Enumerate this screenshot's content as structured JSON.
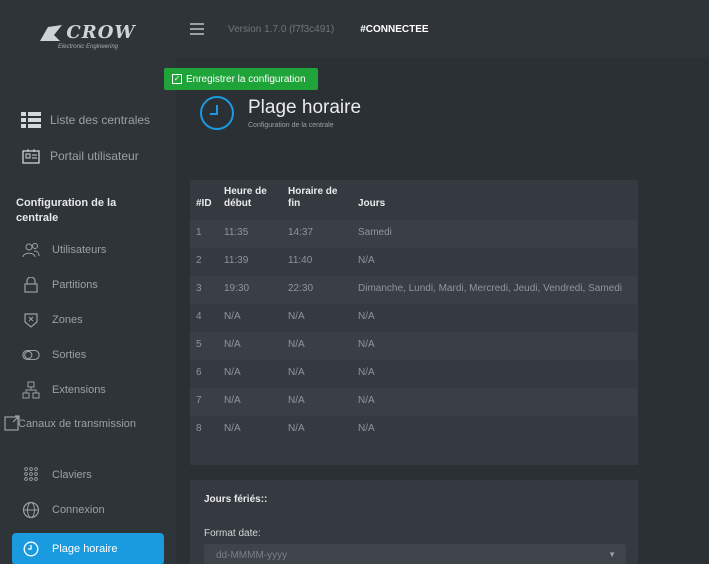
{
  "brand": {
    "name": "CROW",
    "tagline": "Electronic Engineering"
  },
  "topbar": {
    "version": "Version 1.7.0 (f7f3c491)",
    "status": "#CONNECTEE"
  },
  "toolbar": {
    "save_label": "Enregistrer la configuration"
  },
  "nav": {
    "links": [
      {
        "label": "Liste des centrales",
        "icon": "list-icon"
      },
      {
        "label": "Portail utilisateur",
        "icon": "portal-icon"
      }
    ],
    "section_title": "Configuration de la centrale",
    "items": [
      {
        "label": "Utilisateurs",
        "icon": "users-icon"
      },
      {
        "label": "Partitions",
        "icon": "partitions-icon"
      },
      {
        "label": "Zones",
        "icon": "zones-icon"
      },
      {
        "label": "Sorties",
        "icon": "outputs-icon"
      },
      {
        "label": "Extensions",
        "icon": "extensions-icon"
      },
      {
        "label": "Canaux de transmission",
        "icon": "transmission-icon"
      },
      {
        "label": "Claviers",
        "icon": "keypad-icon"
      },
      {
        "label": "Connexion",
        "icon": "globe-icon"
      },
      {
        "label": "Plage horaire",
        "icon": "clock-icon",
        "active": true
      }
    ]
  },
  "page": {
    "title": "Plage horaire",
    "subtitle": "Configuration de la centrale"
  },
  "table": {
    "headers": [
      "#ID",
      "Heure de début",
      "Horaire de fin",
      "Jours"
    ],
    "rows": [
      [
        "1",
        "11:35",
        "14:37",
        "Samedi"
      ],
      [
        "2",
        "11:39",
        "11:40",
        "N/A"
      ],
      [
        "3",
        "19:30",
        "22:30",
        "Dimanche, Lundi, Mardi, Mercredi, Jeudi, Vendredi, Samedi"
      ],
      [
        "4",
        "N/A",
        "N/A",
        "N/A"
      ],
      [
        "5",
        "N/A",
        "N/A",
        "N/A"
      ],
      [
        "6",
        "N/A",
        "N/A",
        "N/A"
      ],
      [
        "7",
        "N/A",
        "N/A",
        "N/A"
      ],
      [
        "8",
        "N/A",
        "N/A",
        "N/A"
      ]
    ]
  },
  "holidays": {
    "title": "Jours fériés::",
    "format_label": "Format date:",
    "format_value": "dd-MMMM-yyyy"
  },
  "colors": {
    "accent": "#1a9be0",
    "save": "#1fa43a",
    "bg": "#2b3035",
    "sidebar": "#2f3439"
  }
}
